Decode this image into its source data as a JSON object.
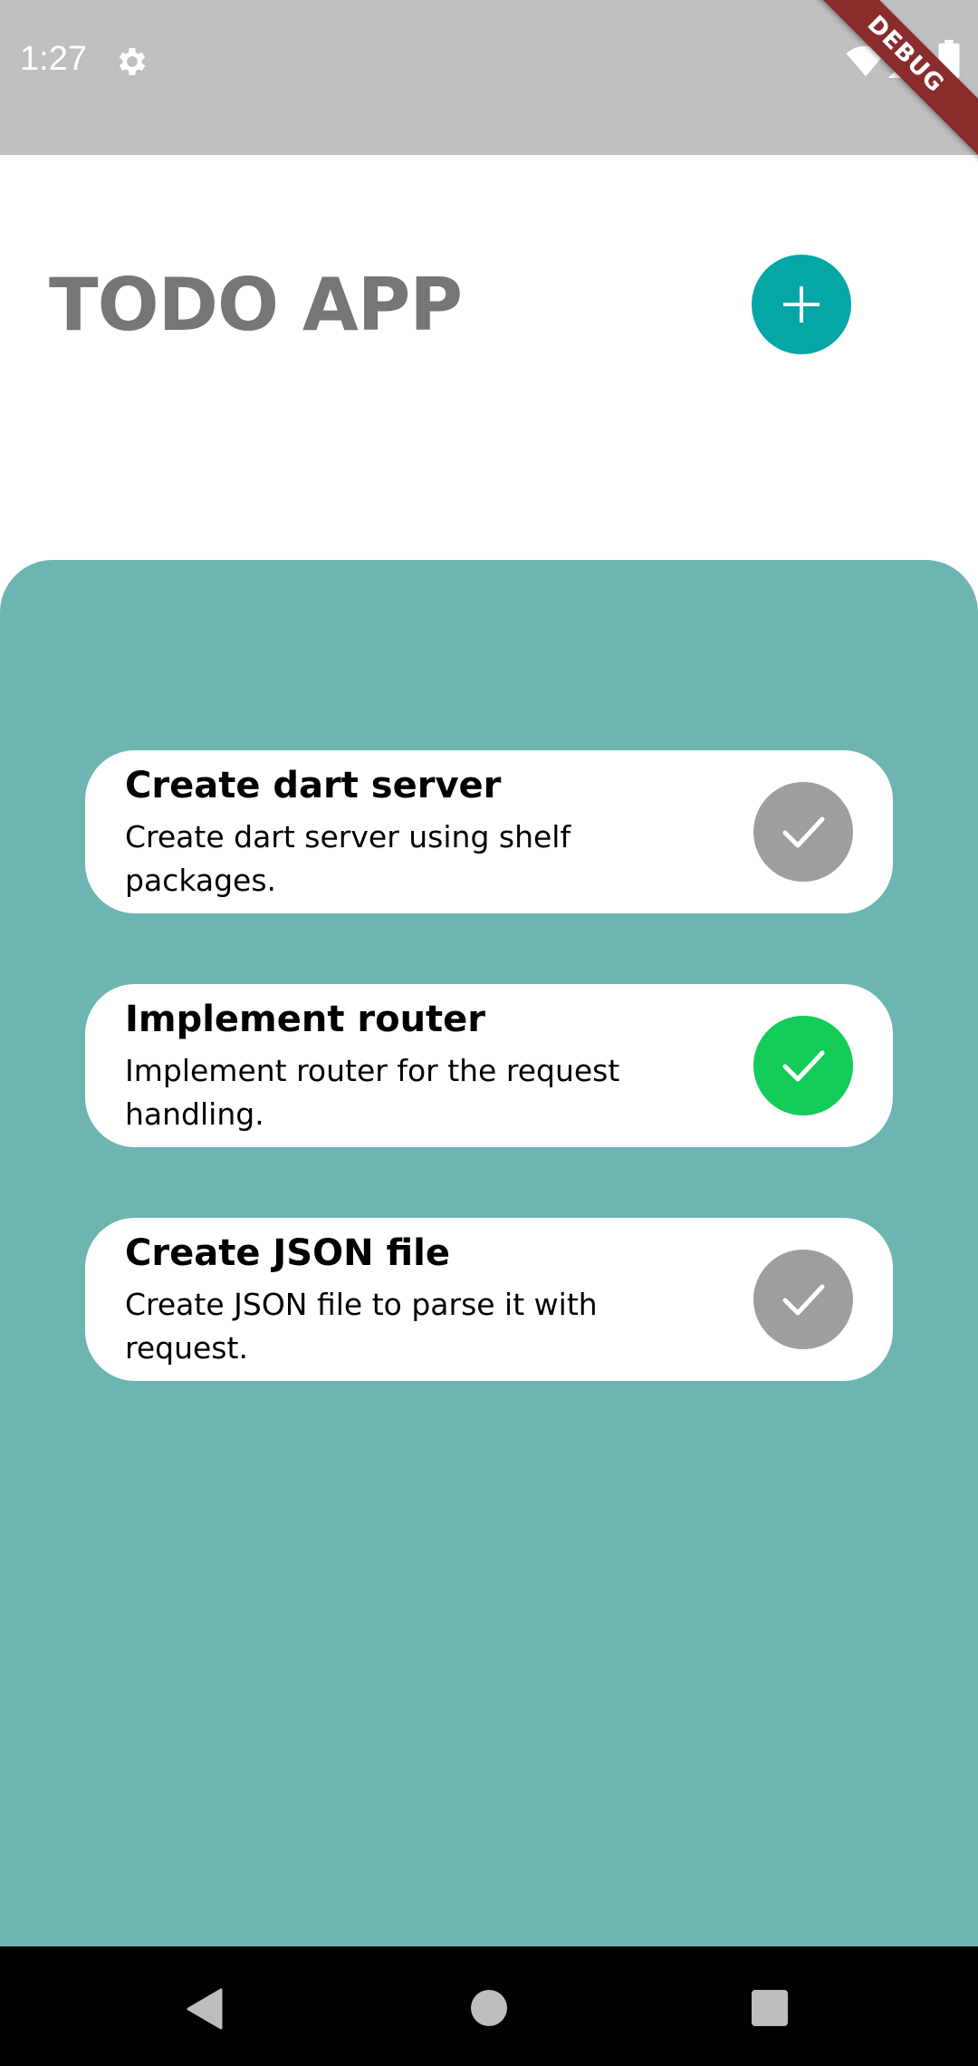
{
  "status_bar": {
    "time": "1:27",
    "debug_label": "DEBUG",
    "icons": [
      "gear-icon",
      "wifi-icon",
      "signal-icon",
      "battery-icon"
    ]
  },
  "header": {
    "title": "TODO APP",
    "add_icon": "plus-icon"
  },
  "colors": {
    "accent": "#05a6a6",
    "panel": "#6db5b1",
    "done": "#14cc5a",
    "not_done": "#9e9e9e",
    "title_gray": "#767676"
  },
  "todos": [
    {
      "title": "Create dart server",
      "description": "Create dart server using shelf packages.",
      "done": false
    },
    {
      "title": "Implement router",
      "description": "Implement router for the request handling.",
      "done": true
    },
    {
      "title": "Create JSON file",
      "description": "Create JSON file to parse it with request.",
      "done": false
    }
  ],
  "nav_bar": {
    "icons": [
      "back-icon",
      "home-icon",
      "recents-icon"
    ]
  }
}
